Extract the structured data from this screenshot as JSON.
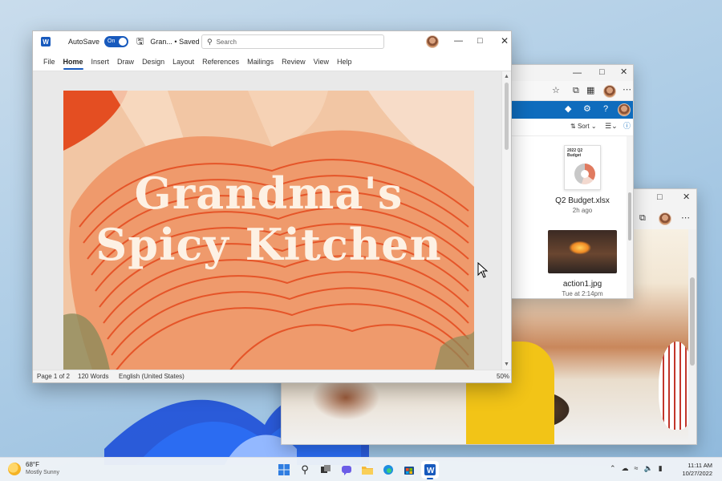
{
  "word": {
    "autosave_label": "AutoSave",
    "autosave_state": "On",
    "doc_title": "Gran... • Saved",
    "search_placeholder": "Search",
    "tabs": [
      "File",
      "Home",
      "Insert",
      "Draw",
      "Design",
      "Layout",
      "References",
      "Mailings",
      "Review",
      "View",
      "Help"
    ],
    "active_tab": "Home",
    "document_heading_line1": "Grandma's",
    "document_heading_line2": "Spicy Kitchen",
    "status": {
      "page": "Page 1 of 2",
      "words": "120 Words",
      "language": "English (United States)",
      "zoom": "50%"
    }
  },
  "files_window": {
    "sort_label": "Sort",
    "files": [
      {
        "name": "Q2 Budget.xlsx",
        "date": "2h ago",
        "thumb_caption": "2022 Q2 Budget"
      },
      {
        "name": "action1.jpg",
        "date": "Tue at 2:14pm"
      }
    ]
  },
  "taskbar": {
    "weather_temp": "68°F",
    "weather_condition": "Mostly Sunny",
    "time": "11:11 AM",
    "date": "10/27/2022"
  },
  "colors": {
    "word_blue": "#185abd",
    "onedrive_blue": "#0f6cbd",
    "page_peach": "#f4c8a6",
    "art_orange": "#e8552a"
  }
}
